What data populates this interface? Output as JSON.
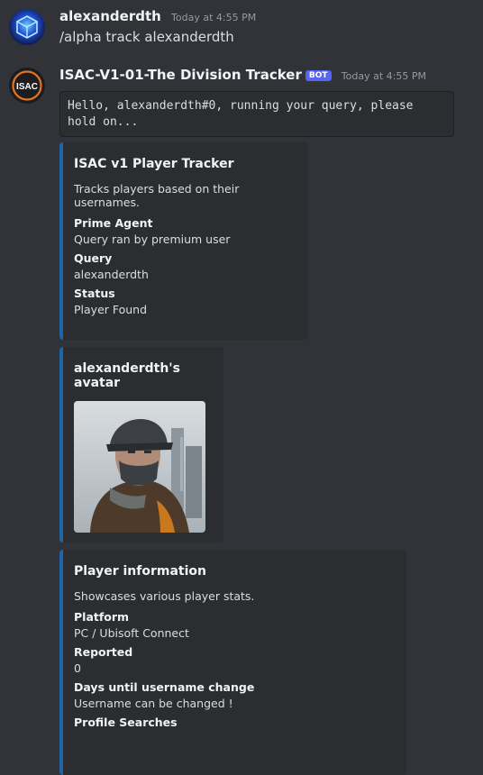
{
  "user_message": {
    "username": "alexanderdth",
    "timestamp": "Today at 4:55 PM",
    "text": "/alpha track alexanderdth"
  },
  "bot_message": {
    "username": "ISAC-V1-01-The Division Tracker",
    "bot_badge": "BOT",
    "timestamp": "Today at 4:55 PM",
    "avatar_label": "ISAC",
    "code_text": "Hello, alexanderdth#0, running your query, please hold on..."
  },
  "embeds": {
    "tracker": {
      "title": "ISAC v1 Player Tracker",
      "description": "Tracks players based on their usernames.",
      "fields": [
        {
          "name": "Prime Agent",
          "value": "Query ran by premium user"
        },
        {
          "name": "Query",
          "value": "alexanderdth"
        },
        {
          "name": "Status",
          "value": "Player Found"
        }
      ]
    },
    "avatar": {
      "title": "alexanderdth's avatar"
    },
    "player_info": {
      "title": "Player information",
      "description": "Showcases various player stats.",
      "fields": [
        {
          "name": "Platform",
          "value": "PC / Ubisoft Connect"
        },
        {
          "name": "Reported",
          "value": "0"
        },
        {
          "name": "Days until username change",
          "value": "Username can be changed !"
        },
        {
          "name": "Profile Searches",
          "value": ""
        }
      ]
    }
  },
  "colors": {
    "background": "#313338",
    "embed_bg": "#2b2d31",
    "embed_accent": "#1e66a8",
    "bot_badge": "#5865f2"
  }
}
